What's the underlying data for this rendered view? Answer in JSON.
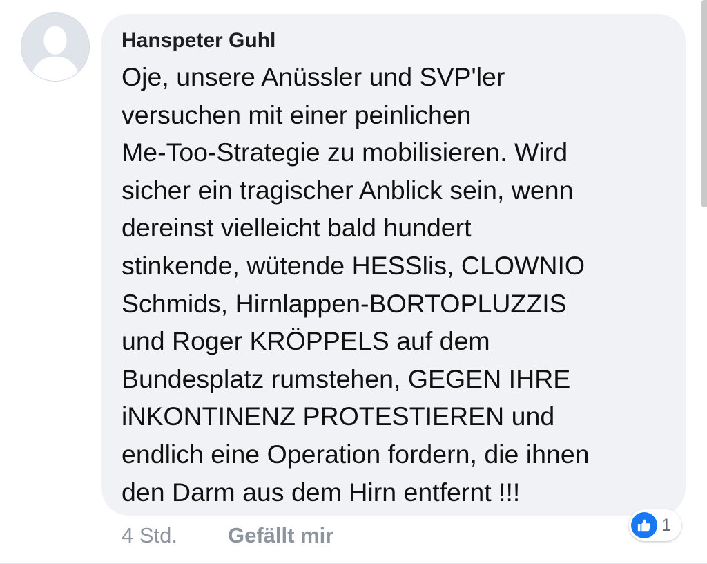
{
  "comment": {
    "author": "Hanspeter Guhl",
    "text": "Oje, unsere Anüssler und SVP'ler\nversuchen mit einer peinlichen\nMe-Too-Strategie zu mobilisieren. Wird\nsicher ein tragischer Anblick sein, wenn\ndereinst vielleicht bald hundert\nstinkende, wütende HESSlis, CLOWNIO\nSchmids, Hirnlappen-BORTOPLUZZIS\nund Roger KRÖPPELS auf dem\nBundesplatz rumstehen, GEGEN IHRE\niNKONTINENZ PROTESTIEREN und\nendlich eine Operation fordern, die ihnen\nden Darm aus dem Hirn entfernt !!!",
    "timestamp": "4 Std.",
    "like_label": "Gefällt mir",
    "reaction_count": "1"
  },
  "icons": {
    "avatar": "default-profile-silhouette",
    "reaction": "thumbs-up-icon"
  },
  "colors": {
    "bubble_background": "#f1f2f5",
    "meta_text": "#8d949e",
    "like_accent": "#1877f2"
  }
}
